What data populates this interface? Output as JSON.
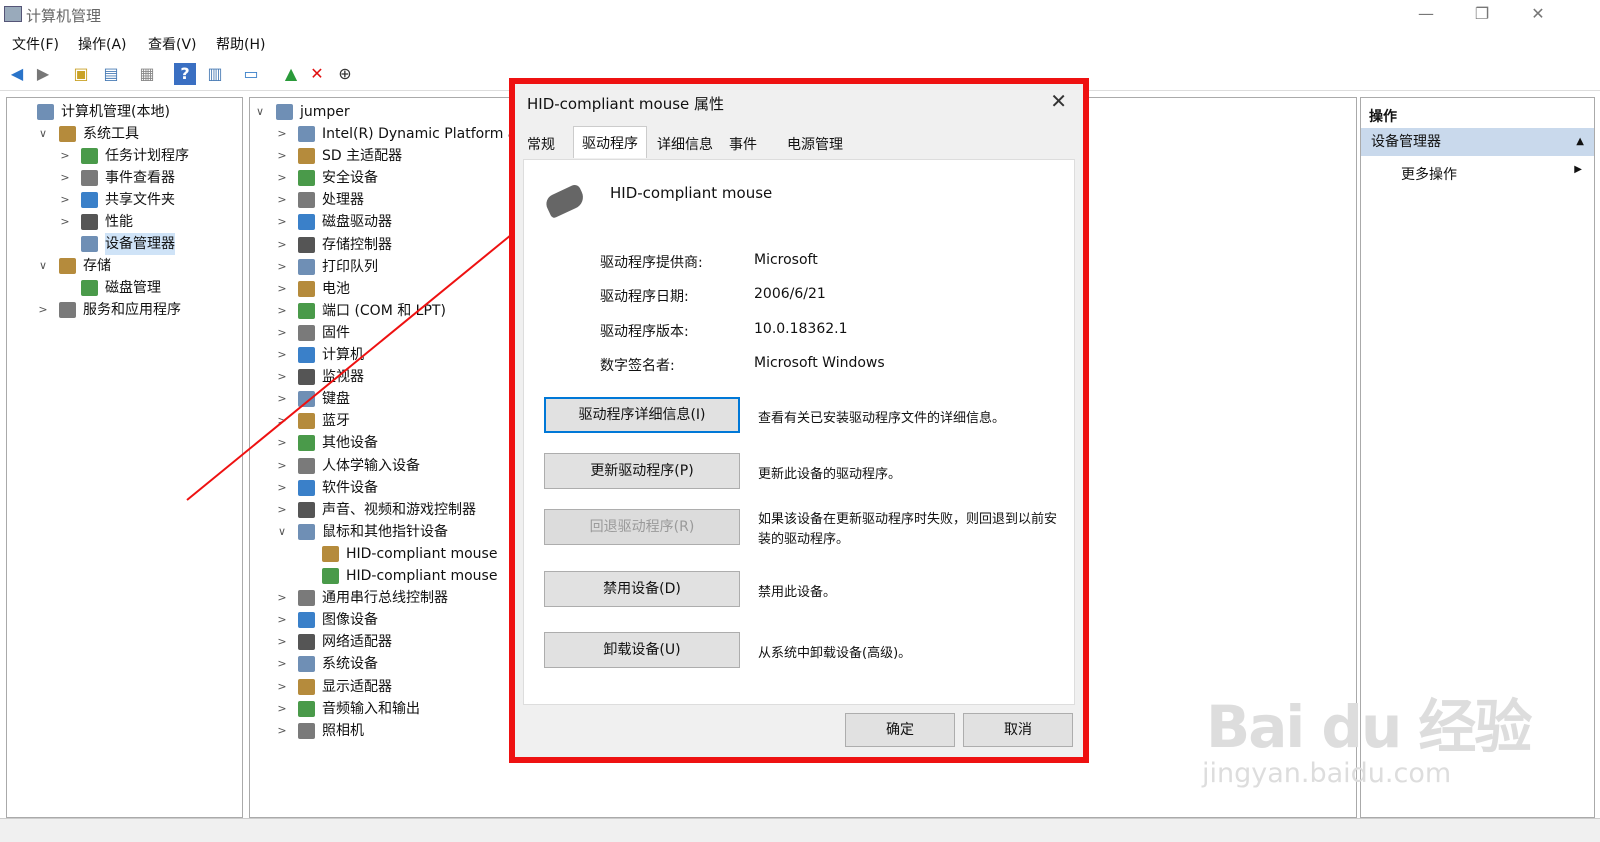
{
  "window": {
    "title": "计算机管理",
    "min": "—",
    "restore": "❐",
    "close": "✕"
  },
  "menu": [
    "文件(F)",
    "操作(A)",
    "查看(V)",
    "帮助(H)"
  ],
  "toolbar_icons": [
    "back-arrow-icon",
    "forward-arrow-icon",
    "up-folder-icon",
    "show-hide-tree-icon",
    "properties-icon",
    "help-icon",
    "action-pane-icon",
    "monitor-icon",
    "update-driver-icon",
    "uninstall-icon",
    "download-icon"
  ],
  "left_tree": [
    {
      "label": "计算机管理(本地)",
      "level": 0,
      "exp": ""
    },
    {
      "label": "系统工具",
      "level": 1,
      "exp": "∨"
    },
    {
      "label": "任务计划程序",
      "level": 2,
      "exp": ">"
    },
    {
      "label": "事件查看器",
      "level": 2,
      "exp": ">"
    },
    {
      "label": "共享文件夹",
      "level": 2,
      "exp": ">"
    },
    {
      "label": "性能",
      "level": 2,
      "exp": ">"
    },
    {
      "label": "设备管理器",
      "level": 2,
      "exp": "",
      "selected": true
    },
    {
      "label": "存储",
      "level": 1,
      "exp": "∨"
    },
    {
      "label": "磁盘管理",
      "level": 2,
      "exp": ""
    },
    {
      "label": "服务和应用程序",
      "level": 1,
      "exp": ">"
    }
  ],
  "device_tree": {
    "root": "jumper",
    "items": [
      {
        "label": "Intel(R) Dynamic Platform a",
        "exp": ">"
      },
      {
        "label": "SD 主适配器",
        "exp": ">"
      },
      {
        "label": "安全设备",
        "exp": ">"
      },
      {
        "label": "处理器",
        "exp": ">"
      },
      {
        "label": "磁盘驱动器",
        "exp": ">"
      },
      {
        "label": "存储控制器",
        "exp": ">"
      },
      {
        "label": "打印队列",
        "exp": ">"
      },
      {
        "label": "电池",
        "exp": ">"
      },
      {
        "label": "端口 (COM 和 LPT)",
        "exp": ">"
      },
      {
        "label": "固件",
        "exp": ">"
      },
      {
        "label": "计算机",
        "exp": ">"
      },
      {
        "label": "监视器",
        "exp": ">"
      },
      {
        "label": "键盘",
        "exp": ">"
      },
      {
        "label": "蓝牙",
        "exp": ">"
      },
      {
        "label": "其他设备",
        "exp": ">"
      },
      {
        "label": "人体学输入设备",
        "exp": ">"
      },
      {
        "label": "软件设备",
        "exp": ">"
      },
      {
        "label": "声音、视频和游戏控制器",
        "exp": ">"
      },
      {
        "label": "鼠标和其他指针设备",
        "exp": "∨"
      },
      {
        "label": "HID-compliant mouse",
        "exp": "",
        "child": true
      },
      {
        "label": "HID-compliant mouse",
        "exp": "",
        "child": true
      },
      {
        "label": "通用串行总线控制器",
        "exp": ">"
      },
      {
        "label": "图像设备",
        "exp": ">"
      },
      {
        "label": "网络适配器",
        "exp": ">"
      },
      {
        "label": "系统设备",
        "exp": ">"
      },
      {
        "label": "显示适配器",
        "exp": ">"
      },
      {
        "label": "音频输入和输出",
        "exp": ">"
      },
      {
        "label": "照相机",
        "exp": ">"
      }
    ]
  },
  "actions": {
    "header": "操作",
    "section": "设备管理器",
    "more": "更多操作",
    "up": "▲",
    "arrow": "▶"
  },
  "dialog": {
    "title": "HID-compliant mouse 属性",
    "tabs": [
      "常规",
      "驱动程序",
      "详细信息",
      "事件",
      "电源管理"
    ],
    "active_tab": 1,
    "device_name": "HID-compliant mouse",
    "info": [
      {
        "label": "驱动程序提供商:",
        "value": "Microsoft"
      },
      {
        "label": "驱动程序日期:",
        "value": "2006/6/21"
      },
      {
        "label": "驱动程序版本:",
        "value": "10.0.18362.1"
      },
      {
        "label": "数字签名者:",
        "value": "Microsoft Windows"
      }
    ],
    "buttons": [
      {
        "label": "驱动程序详细信息(I)",
        "desc": "查看有关已安装驱动程序文件的详细信息。",
        "state": "focus"
      },
      {
        "label": "更新驱动程序(P)",
        "desc": "更新此设备的驱动程序。",
        "state": "normal"
      },
      {
        "label": "回退驱动程序(R)",
        "desc": "如果该设备在更新驱动程序时失败，则回退到以前安装的驱动程序。",
        "state": "disabled"
      },
      {
        "label": "禁用设备(D)",
        "desc": "禁用此设备。",
        "state": "normal"
      },
      {
        "label": "卸载设备(U)",
        "desc": "从系统中卸载设备(高级)。",
        "state": "normal"
      }
    ],
    "ok": "确定",
    "cancel": "取消",
    "close": "✕"
  },
  "watermark": {
    "main": "Bai du 经验",
    "sub": "jingyan.baidu.com"
  },
  "colors": {
    "highlight": "#ee1111",
    "selection": "#cfe3f7",
    "action_section": "#c9d9ec"
  }
}
